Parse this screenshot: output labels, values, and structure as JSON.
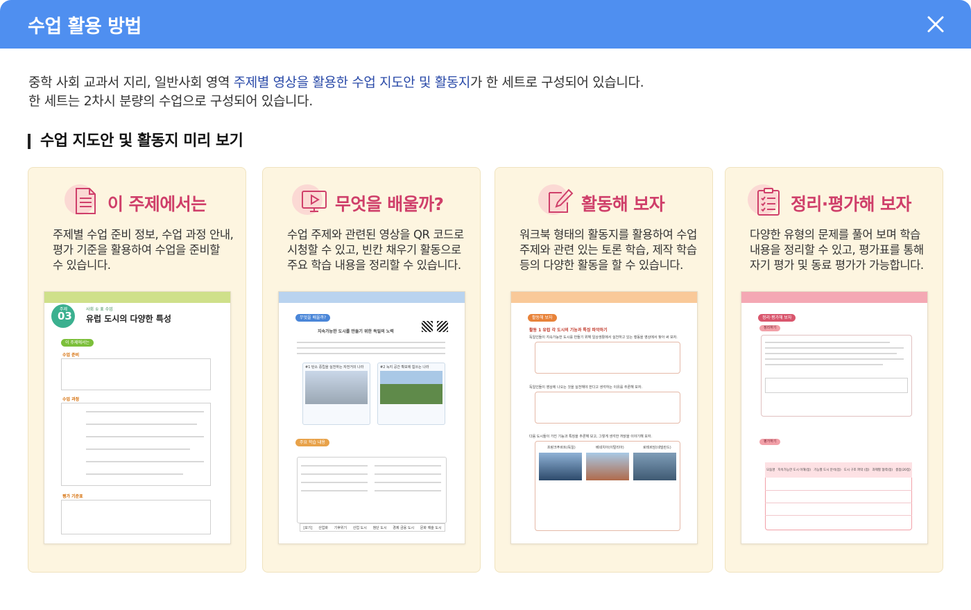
{
  "header": {
    "title": "수업 활용 방법",
    "close_icon": "close-icon"
  },
  "intro": {
    "line1_pre": "중학 사회 교과서 지리, 일반사회 영역 ",
    "line1_highlight": "주제별 영상을 활용한 수업 지도안 및 활동지",
    "line1_post": "가 한 세트로 구성되어 있습니다.",
    "line2": "한 세트는 2차시 분량의 수업으로 구성되어 있습니다.",
    "highlight_color": "#2a4aa8"
  },
  "section": {
    "title": "수업 지도안 및 활동지 미리 보기"
  },
  "colors": {
    "header_bg": "#4f8ff0",
    "card_bg": "#fdf5e0",
    "card_title": "#cf3f6a",
    "icon_blob": "#fbd9d4"
  },
  "cards": [
    {
      "icon": "document-list-icon",
      "title": "이 주제에서는",
      "desc": [
        "주제별 수업 준비 정보, 수업 과정 안내,",
        "평가 기준을 활용하여  수업을 준비할",
        "수 있습니다."
      ],
      "preview": {
        "topic_num": "03",
        "topic_label": "주제",
        "subject": "사회 ① 표 수업",
        "title": "유럽 도시의 다양한 특성",
        "pill": "이 주제에서는",
        "sections": [
          "수업 준비",
          "수업 과정",
          "평가 기준표"
        ],
        "bar_color": "#cfe08a"
      }
    },
    {
      "icon": "monitor-play-icon",
      "title": "무엇을 배울까?",
      "desc": [
        "수업 주제와 관련된 영상을 QR 코드로",
        "시청할 수 있고, 빈칸 채우기 활동으로",
        "주요 학습 내용을 정리할 수 있습니다."
      ],
      "preview": {
        "pill": "무엇을 배울까?",
        "subtitle": "지속가능한 도시를 만들기 위한 독일의 노력",
        "img1_label": "#1 탄소 중립을 실천하는 자전거의 나라",
        "img2_label": "#2 녹지 공간 확보에 힘쓰는 나라",
        "pill2": "주요 학습 내용",
        "words": [
          "[보기]",
          "산업화",
          "기후위기",
          "산업 도시",
          "첨단 도시",
          "경제 금융 도시",
          "문화 예술 도시"
        ],
        "bar_color": "#b9d3ef"
      }
    },
    {
      "icon": "pencil-paper-icon",
      "title": "활동해 보자",
      "desc": [
        "워크북 형태의 활동지를 활용하여 수업",
        "주제와 관련 있는 토론 학습, 제작 학습",
        "등의  다양한  활동을  할  수  있습니다."
      ],
      "preview": {
        "pill": "활동해 보자",
        "activity": "활동 1  유럽 각 도시의 기능과 특징 파악하기",
        "q1": "독일인들이 지속가능한 도시를 만들기 위해 일상생활에서 실천하고 있는 행동을 영상에서 찾아 써 보자.",
        "q2": "독일인들이 영상에 나오는 것을 실천해야 한다고 생각하는 이유를 추론해 보자.",
        "q3": "다음 도시들이 가진 기능과 특징을 추론해 보고, 그렇게 생각한 까닭을 이야기해 보자.",
        "cities": [
          "프랑크푸르트(독일)",
          "베네치아(이탈리아)",
          "로테르담(네덜란드)"
        ],
        "bar_color": "#f9c999"
      }
    },
    {
      "icon": "clipboard-check-icon",
      "title": "정리·평가해 보자",
      "desc": [
        "다양한 유형의 문제를 풀어 보며 학습",
        "내용을 정리할 수 있고, 평가표를 통해",
        "자기 평가 및 동료 평가가 가능합니다."
      ],
      "preview": {
        "pill": "정리·평가해 보자",
        "part1": "정리하기",
        "part2": "평가하기",
        "cols": [
          "모둠명",
          "지속가능한 도시 이해(점)",
          "기능별 도시 분석(점)",
          "도시 구조 파악 (점)",
          "과제별 협력(점)",
          "총점(20점)"
        ],
        "bar_color": "#f4a8b4"
      }
    }
  ]
}
